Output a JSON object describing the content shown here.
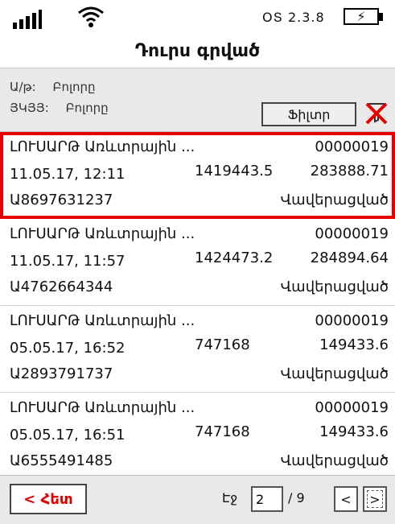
{
  "status": {
    "version": "ՕՏ 2.3.8",
    "battery_symbol": "⚡"
  },
  "title": "Դուրս գրված",
  "filter": {
    "label1": "Ա/թ:",
    "value1": "Բոլորը",
    "label2": "ՅԿՅՅ:",
    "value2": "Բոլորը",
    "button_label": "Ֆիլտր"
  },
  "items": [
    {
      "name": "ԼՈՒՍԱՐԹ Առևտրային ...",
      "number": "00000019",
      "datetime": "11.05.17, 12:11",
      "amount1": "1419443.5",
      "amount2": "283888.71",
      "code": "Ա8697631237",
      "status": "Վավերացված"
    },
    {
      "name": "ԼՈՒՍԱՐԹ Առևտրային ...",
      "number": "00000019",
      "datetime": "11.05.17, 11:57",
      "amount1": "1424473.2",
      "amount2": "284894.64",
      "code": "Ա4762664344",
      "status": "Վավերացված"
    },
    {
      "name": "ԼՈՒՍԱՐԹ Առևտրային ...",
      "number": "00000019",
      "datetime": "05.05.17, 16:52",
      "amount1": "747168",
      "amount2": "149433.6",
      "code": "Ա2893791737",
      "status": "Վավերացված"
    },
    {
      "name": "ԼՈՒՍԱՐԹ Առևտրային ...",
      "number": "00000019",
      "datetime": "05.05.17, 16:51",
      "amount1": "747168",
      "amount2": "149433.6",
      "code": "Ա6555491485",
      "status": "Վավերացված"
    }
  ],
  "pagination": {
    "back_label": "< Հետ",
    "page_label": "Էջ",
    "current_page": "2",
    "total": "/ 9",
    "prev_label": "<",
    "next_label": ">"
  },
  "colors": {
    "accent": "#e60000",
    "panel": "#e9e9e9"
  }
}
